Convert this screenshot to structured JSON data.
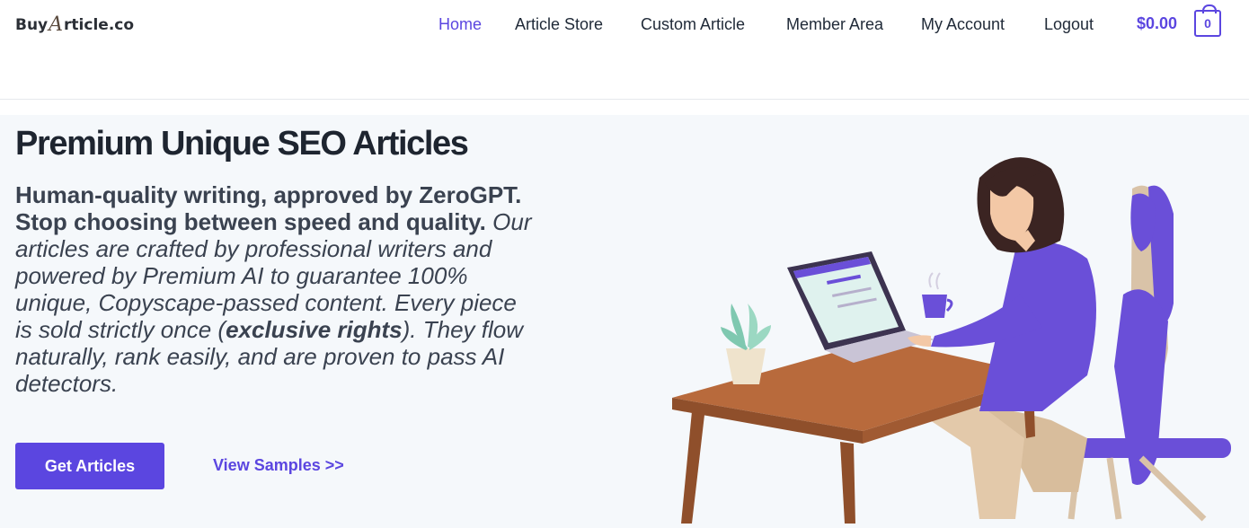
{
  "header": {
    "logo": {
      "part1": "Buy",
      "part2": "A",
      "part3": "rticle.co"
    },
    "nav": [
      {
        "label": "Home",
        "active": true
      },
      {
        "label": "Article Store"
      },
      {
        "label": "Custom Article"
      },
      {
        "label": "Member Area"
      },
      {
        "label": "My Account"
      },
      {
        "label": "Logout"
      }
    ],
    "cart": {
      "total": "$0.00",
      "count": "0"
    }
  },
  "hero": {
    "title": "Premium Unique SEO Articles",
    "desc_strong": "Human-quality writing, approved by ZeroGPT. Stop choosing between speed and quality.",
    "desc_italic_1": " Our articles are crafted by professional writers and powered by Premium AI to guarantee 100% unique, Copyscape-passed content. Every piece is sold strictly once (",
    "desc_italic_bold": "exclusive rights",
    "desc_italic_2": "). They flow naturally, rank easily, and are proven to pass AI detectors.",
    "primary_button": "Get Articles",
    "secondary_link": "View Samples >>"
  },
  "colors": {
    "accent": "#5b46e0",
    "hero_bg": "#f5f8fb",
    "heading": "#1e2530"
  }
}
